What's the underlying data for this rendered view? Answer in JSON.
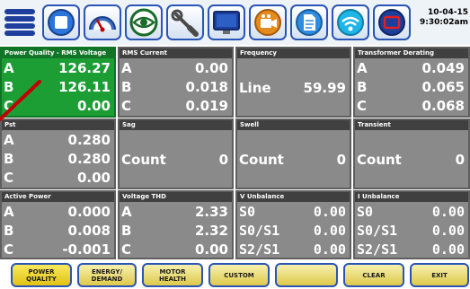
{
  "toolbar": {
    "icons": [
      "menu-icon",
      "stop-icon",
      "gauge-icon",
      "eye-icon",
      "wrench-icon",
      "monitor-icon",
      "camera-icon",
      "document-icon",
      "wifi-icon",
      "display-frame-icon"
    ],
    "clock_date": "10-04-15",
    "clock_time": "9:30:02am"
  },
  "tiles": {
    "pq": {
      "title": "Power Quality - RMS Voltage",
      "a": "126.27",
      "b": "126.11",
      "c": "0.00"
    },
    "rms_current": {
      "title": "RMS Current",
      "a": "0.00",
      "b": "0.018",
      "c": "0.019"
    },
    "frequency": {
      "title": "Frequency",
      "label": "Line",
      "value": "59.99"
    },
    "transformer": {
      "title": "Transformer Derating",
      "a": "0.049",
      "b": "0.065",
      "c": "0.068"
    },
    "pst": {
      "title": "Pst",
      "a": "0.280",
      "b": "0.280",
      "c": "0.00"
    },
    "sag": {
      "title": "Sag",
      "label": "Count",
      "value": "0"
    },
    "swell": {
      "title": "Swell",
      "label": "Count",
      "value": "0"
    },
    "transient": {
      "title": "Transient",
      "label": "Count",
      "value": "0"
    },
    "active_power": {
      "title": "Active Power",
      "a": "0.000",
      "b": "0.008",
      "c": "-0.001"
    },
    "voltage_thd": {
      "title": "Voltage THD",
      "a": "2.33",
      "b": "2.32",
      "c": "0.00"
    },
    "v_unbalance": {
      "title": "V Unbalance",
      "r1l": "S0",
      "r1v": "0.00",
      "r2l": "S0/S1",
      "r2v": "0.00",
      "r3l": "S2/S1",
      "r3v": "0.00"
    },
    "i_unbalance": {
      "title": "I Unbalance",
      "r1l": "S0",
      "r1v": "0.00",
      "r2l": "S0/S1",
      "r2v": "0.00",
      "r3l": "S2/S1",
      "r3v": "0.00"
    }
  },
  "phase_labels": {
    "a": "A",
    "b": "B",
    "c": "C"
  },
  "bottom": {
    "power_quality": "POWER\nQUALITY",
    "energy_demand": "ENERGY/\nDEMAND",
    "motor_health": "MOTOR\nHEALTH",
    "custom": "CUSTOM",
    "blank": "",
    "clear": "CLEAR",
    "exit": "EXIT"
  },
  "colors": {
    "active_tile": "#1c9e35",
    "tile": "#8a8a8a",
    "button_border": "#2a54b6",
    "annotation": "#c00000"
  }
}
